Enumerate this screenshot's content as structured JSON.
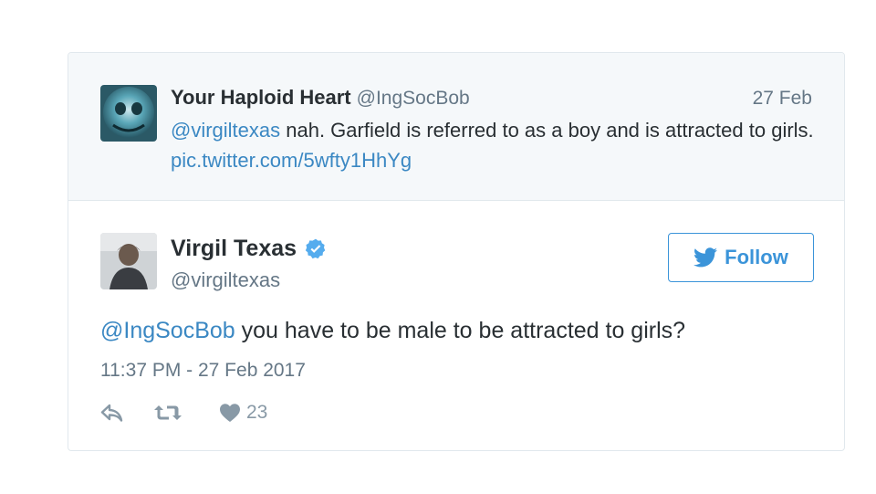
{
  "quoted_tweet": {
    "display_name": "Your Haploid Heart",
    "handle": "@IngSocBob",
    "date": "27 Feb",
    "mention": "@virgiltexas",
    "text_part1": " nah. Garfield is referred to as a boy and is attracted to girls. ",
    "pic_link": "pic.twitter.com/5wfty1HhYg"
  },
  "main_tweet": {
    "display_name": "Virgil Texas",
    "handle": "@virgiltexas",
    "follow_label": "Follow",
    "mention": "@IngSocBob",
    "text": " you have to be male to be attracted to girls?",
    "timestamp": "11:37 PM - 27 Feb 2017",
    "likes": "23"
  },
  "colors": {
    "link": "#3b88c3",
    "follow_border": "#3b94d9",
    "verified": "#55acee",
    "quoted_bg": "#f5f8fa"
  }
}
